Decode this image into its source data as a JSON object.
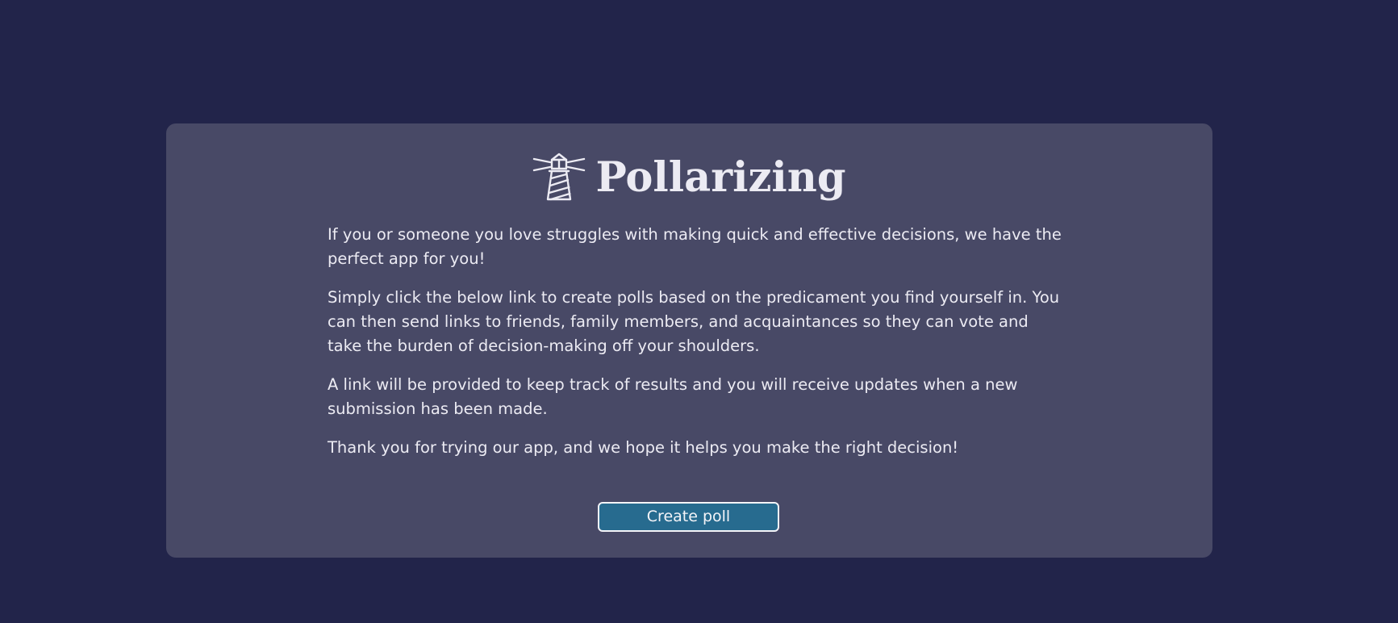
{
  "app": {
    "title": "Pollarizing",
    "logo_icon": "lighthouse-icon"
  },
  "intro": {
    "paragraphs": [
      "If you or someone you love struggles with making quick and effective decisions, we have the perfect app for you!",
      "Simply click the below link to create polls based on the predicament you find yourself in. You can then send links to friends, family members, and acquaintances so they can vote and take the burden of decision-making off your shoulders.",
      "A link will be provided to keep track of results and you will receive updates when a new submission has been made.",
      "Thank you for trying our app, and we hope it helps you make the right decision!"
    ]
  },
  "actions": {
    "create_poll_label": "Create poll"
  },
  "colors": {
    "page_background": "#22244a",
    "card_background": "#484966",
    "button_background": "#276b8f",
    "text": "#ecebf3"
  }
}
